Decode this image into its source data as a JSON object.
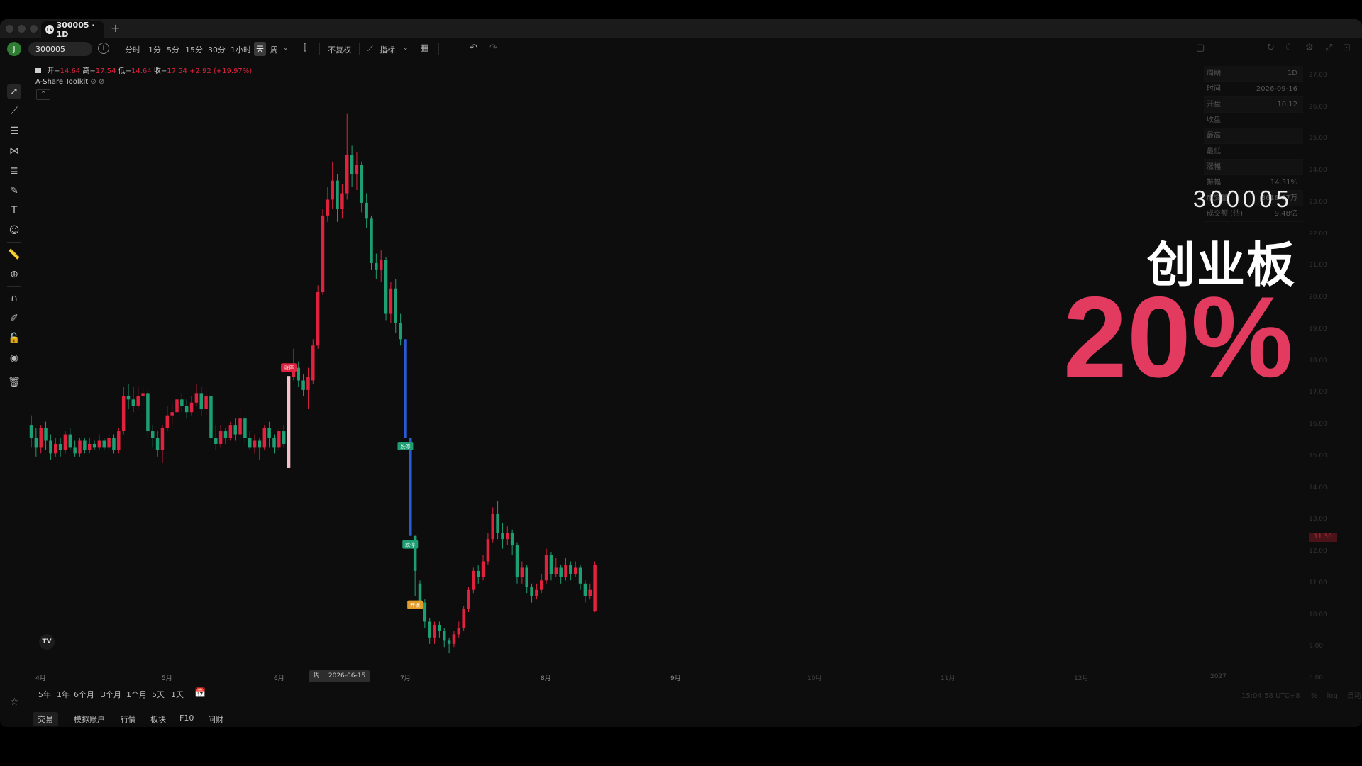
{
  "tab": {
    "title": "300005 · 1D",
    "logo": "TV",
    "new_tab": "+"
  },
  "toolbar": {
    "avatar": "J",
    "symbol": "300005",
    "add_symbol": "+",
    "intervals": [
      "分时",
      "1分",
      "5分",
      "15分",
      "30分",
      "1小时",
      "天",
      "周"
    ],
    "active_interval": "天",
    "adjust": "不复权",
    "indicators": "指标"
  },
  "legend": {
    "open_label": "开=",
    "open": "14.64",
    "high_label": "高=",
    "high": "17.54",
    "low_label": "低=",
    "low": "14.64",
    "close_label": "收=",
    "close": "17.54",
    "change": "+2.92 (+19.97%)"
  },
  "indicator": {
    "name": "A-Share Toolkit"
  },
  "info_panel": [
    {
      "label": "周期",
      "value": "1D"
    },
    {
      "label": "时间",
      "value": "2026-09-16"
    },
    {
      "label": "开盘",
      "value": "10.12"
    },
    {
      "label": "收盘",
      "value": ""
    },
    {
      "label": "最高",
      "value": ""
    },
    {
      "label": "最低",
      "value": ""
    },
    {
      "label": "涨幅",
      "value": ""
    },
    {
      "label": "振幅",
      "value": "14.31%"
    },
    {
      "label": "成交量",
      "value": "8618.87万"
    },
    {
      "label": "成交额 (估)",
      "value": "9.48亿"
    }
  ],
  "price_axis": [
    "27.00",
    "26.00",
    "25.00",
    "24.00",
    "23.00",
    "22.00",
    "21.00",
    "20.00",
    "19.00",
    "18.00",
    "17.00",
    "16.00",
    "15.00",
    "14.00",
    "13.00",
    "12.00",
    "11.00",
    "10.00",
    "9.00",
    "8.00"
  ],
  "price_tag": "11.30",
  "x_axis": [
    "4月",
    "5月",
    "6月",
    "7月",
    "8月",
    "9月",
    "10月",
    "11月",
    "12月",
    "2027"
  ],
  "x_hover": "周一 2026-06-15",
  "ranges": [
    "5年",
    "1年",
    "6个月",
    "3个月",
    "1个月",
    "5天",
    "1天"
  ],
  "timezone": "15:04:58 UTC+8",
  "axis_opts": [
    "%",
    "log",
    "自动"
  ],
  "bottom_tabs": [
    "交易",
    "模拟账户",
    "行情",
    "板块",
    "F10",
    "问财"
  ],
  "markers": {
    "limit_up": "涨停",
    "limit_down": "跌停",
    "open_board": "开板"
  },
  "overlay": {
    "code": "300005",
    "board": "创业板",
    "percent": "20%"
  },
  "colors": {
    "up": "#e0223f",
    "down": "#1e9e73",
    "limit_down_bar": "#2a5bd7",
    "limit_up_bar": "#f5c2cb",
    "overlay_pct": "#e33a60",
    "open_board": "#e39b2a"
  },
  "chart_data": {
    "type": "candlestick",
    "x_range": [
      "2026-04",
      "2027"
    ],
    "y_range": [
      8,
      27
    ],
    "candles": [
      {
        "o": 16.0,
        "c": 15.6,
        "h": 16.3,
        "l": 15.3
      },
      {
        "o": 15.6,
        "c": 15.3,
        "h": 15.9,
        "l": 15.0
      },
      {
        "o": 15.3,
        "c": 15.9,
        "h": 16.0,
        "l": 15.1
      },
      {
        "o": 15.9,
        "c": 15.5,
        "h": 16.1,
        "l": 15.2
      },
      {
        "o": 15.5,
        "c": 15.1,
        "h": 15.7,
        "l": 14.9
      },
      {
        "o": 15.1,
        "c": 15.4,
        "h": 15.6,
        "l": 15.0
      },
      {
        "o": 15.4,
        "c": 15.2,
        "h": 15.6,
        "l": 15.0
      },
      {
        "o": 15.2,
        "c": 15.7,
        "h": 15.8,
        "l": 15.1
      },
      {
        "o": 15.7,
        "c": 15.3,
        "h": 15.9,
        "l": 15.2
      },
      {
        "o": 15.3,
        "c": 15.1,
        "h": 15.5,
        "l": 15.0
      },
      {
        "o": 15.1,
        "c": 15.5,
        "h": 15.6,
        "l": 15.0
      },
      {
        "o": 15.5,
        "c": 15.2,
        "h": 15.6,
        "l": 15.1
      },
      {
        "o": 15.2,
        "c": 15.4,
        "h": 15.6,
        "l": 15.1
      },
      {
        "o": 15.4,
        "c": 15.3,
        "h": 15.5,
        "l": 15.2
      },
      {
        "o": 15.3,
        "c": 15.5,
        "h": 15.7,
        "l": 15.2
      },
      {
        "o": 15.5,
        "c": 15.3,
        "h": 15.6,
        "l": 15.2
      },
      {
        "o": 15.3,
        "c": 15.6,
        "h": 15.7,
        "l": 15.2
      },
      {
        "o": 15.6,
        "c": 15.2,
        "h": 15.7,
        "l": 15.1
      },
      {
        "o": 15.2,
        "c": 15.8,
        "h": 15.9,
        "l": 15.1
      },
      {
        "o": 15.8,
        "c": 16.9,
        "h": 17.2,
        "l": 15.7
      },
      {
        "o": 16.9,
        "c": 16.8,
        "h": 17.3,
        "l": 16.5
      },
      {
        "o": 16.8,
        "c": 16.6,
        "h": 17.2,
        "l": 16.4
      },
      {
        "o": 16.6,
        "c": 16.9,
        "h": 17.2,
        "l": 16.5
      },
      {
        "o": 16.9,
        "c": 17.0,
        "h": 17.2,
        "l": 16.6
      },
      {
        "o": 17.0,
        "c": 15.8,
        "h": 17.1,
        "l": 15.6
      },
      {
        "o": 15.8,
        "c": 15.6,
        "h": 16.0,
        "l": 15.3
      },
      {
        "o": 15.6,
        "c": 15.2,
        "h": 15.8,
        "l": 15.0
      },
      {
        "o": 15.2,
        "c": 15.9,
        "h": 16.0,
        "l": 14.8
      },
      {
        "o": 15.9,
        "c": 16.3,
        "h": 16.6,
        "l": 15.8
      },
      {
        "o": 16.3,
        "c": 16.4,
        "h": 16.7,
        "l": 16.0
      },
      {
        "o": 16.4,
        "c": 16.8,
        "h": 17.3,
        "l": 16.2
      },
      {
        "o": 16.8,
        "c": 16.6,
        "h": 17.0,
        "l": 16.4
      },
      {
        "o": 16.6,
        "c": 16.4,
        "h": 16.8,
        "l": 16.2
      },
      {
        "o": 16.4,
        "c": 16.7,
        "h": 16.9,
        "l": 16.3
      },
      {
        "o": 16.7,
        "c": 17.0,
        "h": 17.3,
        "l": 16.6
      },
      {
        "o": 17.0,
        "c": 16.5,
        "h": 17.2,
        "l": 16.3
      },
      {
        "o": 16.5,
        "c": 16.9,
        "h": 17.1,
        "l": 16.3
      },
      {
        "o": 16.9,
        "c": 15.6,
        "h": 17.0,
        "l": 15.4
      },
      {
        "o": 15.6,
        "c": 15.4,
        "h": 16.0,
        "l": 15.2
      },
      {
        "o": 15.4,
        "c": 15.8,
        "h": 16.0,
        "l": 15.3
      },
      {
        "o": 15.8,
        "c": 15.6,
        "h": 15.9,
        "l": 15.4
      },
      {
        "o": 15.6,
        "c": 16.0,
        "h": 16.1,
        "l": 15.5
      },
      {
        "o": 16.0,
        "c": 15.7,
        "h": 16.2,
        "l": 15.5
      },
      {
        "o": 15.7,
        "c": 16.2,
        "h": 16.6,
        "l": 15.6
      },
      {
        "o": 16.2,
        "c": 15.6,
        "h": 16.3,
        "l": 15.4
      },
      {
        "o": 15.6,
        "c": 15.3,
        "h": 15.8,
        "l": 15.2
      },
      {
        "o": 15.3,
        "c": 15.5,
        "h": 15.7,
        "l": 15.1
      },
      {
        "o": 15.5,
        "c": 15.3,
        "h": 15.6,
        "l": 14.9
      },
      {
        "o": 15.3,
        "c": 15.9,
        "h": 16.0,
        "l": 15.2
      },
      {
        "o": 15.9,
        "c": 15.6,
        "h": 16.1,
        "l": 15.3
      },
      {
        "o": 15.6,
        "c": 15.3,
        "h": 15.7,
        "l": 15.1
      },
      {
        "o": 15.3,
        "c": 15.8,
        "h": 15.9,
        "l": 15.2
      },
      {
        "o": 15.8,
        "c": 15.4,
        "h": 16.0,
        "l": 15.3
      },
      {
        "o": 14.64,
        "c": 17.54,
        "h": 17.54,
        "l": 14.64,
        "limit": "up"
      },
      {
        "o": 17.5,
        "c": 17.8,
        "h": 18.4,
        "l": 17.4
      },
      {
        "o": 17.8,
        "c": 17.4,
        "h": 18.0,
        "l": 17.2
      },
      {
        "o": 17.4,
        "c": 17.1,
        "h": 17.6,
        "l": 16.9
      },
      {
        "o": 17.1,
        "c": 17.5,
        "h": 17.8,
        "l": 16.5
      },
      {
        "o": 17.4,
        "c": 18.5,
        "h": 18.7,
        "l": 17.3
      },
      {
        "o": 18.5,
        "c": 20.2,
        "h": 20.4,
        "l": 18.4
      },
      {
        "o": 20.2,
        "c": 22.6,
        "h": 22.8,
        "l": 20.1
      },
      {
        "o": 22.6,
        "c": 23.1,
        "h": 23.5,
        "l": 22.4
      },
      {
        "o": 23.1,
        "c": 23.7,
        "h": 24.3,
        "l": 22.8
      },
      {
        "o": 23.7,
        "c": 22.8,
        "h": 23.9,
        "l": 22.4
      },
      {
        "o": 22.8,
        "c": 23.3,
        "h": 23.6,
        "l": 22.5
      },
      {
        "o": 23.3,
        "c": 24.5,
        "h": 25.8,
        "l": 23.1
      },
      {
        "o": 24.5,
        "c": 23.9,
        "h": 24.8,
        "l": 23.5
      },
      {
        "o": 23.9,
        "c": 24.2,
        "h": 24.6,
        "l": 23.4
      },
      {
        "o": 24.2,
        "c": 23.0,
        "h": 24.3,
        "l": 22.7
      },
      {
        "o": 23.0,
        "c": 22.5,
        "h": 23.3,
        "l": 22.2
      },
      {
        "o": 22.5,
        "c": 21.1,
        "h": 22.6,
        "l": 20.9
      },
      {
        "o": 21.1,
        "c": 20.9,
        "h": 21.4,
        "l": 20.6
      },
      {
        "o": 20.9,
        "c": 21.2,
        "h": 21.5,
        "l": 20.5
      },
      {
        "o": 21.2,
        "c": 19.5,
        "h": 21.3,
        "l": 19.3
      },
      {
        "o": 19.5,
        "c": 20.3,
        "h": 20.5,
        "l": 19.2
      },
      {
        "o": 20.3,
        "c": 19.2,
        "h": 20.6,
        "l": 18.9
      },
      {
        "o": 19.2,
        "c": 18.7,
        "h": 19.5,
        "l": 18.5
      },
      {
        "o": 18.7,
        "c": 15.6,
        "h": 18.7,
        "l": 15.6,
        "limit": "down"
      },
      {
        "o": 15.6,
        "c": 12.5,
        "h": 15.6,
        "l": 12.5,
        "limit": "down"
      },
      {
        "o": 12.5,
        "c": 11.4,
        "h": 12.5,
        "l": 10.6
      },
      {
        "o": 11.0,
        "c": 10.4,
        "h": 11.1,
        "l": 10.2
      },
      {
        "o": 10.4,
        "c": 9.8,
        "h": 10.5,
        "l": 9.6
      },
      {
        "o": 9.8,
        "c": 9.3,
        "h": 9.9,
        "l": 9.1
      },
      {
        "o": 9.3,
        "c": 9.7,
        "h": 9.8,
        "l": 9.1
      },
      {
        "o": 9.7,
        "c": 9.5,
        "h": 9.8,
        "l": 9.3
      },
      {
        "o": 9.5,
        "c": 9.2,
        "h": 9.6,
        "l": 9.0
      },
      {
        "o": 9.2,
        "c": 9.1,
        "h": 9.3,
        "l": 8.8
      },
      {
        "o": 9.1,
        "c": 9.4,
        "h": 9.5,
        "l": 9.0
      },
      {
        "o": 9.4,
        "c": 9.6,
        "h": 9.8,
        "l": 9.3
      },
      {
        "o": 9.6,
        "c": 10.2,
        "h": 10.3,
        "l": 9.5
      },
      {
        "o": 10.2,
        "c": 10.8,
        "h": 10.9,
        "l": 10.1
      },
      {
        "o": 10.8,
        "c": 11.4,
        "h": 11.5,
        "l": 10.7
      },
      {
        "o": 11.4,
        "c": 11.2,
        "h": 11.6,
        "l": 11.0
      },
      {
        "o": 11.2,
        "c": 11.7,
        "h": 11.9,
        "l": 11.1
      },
      {
        "o": 11.7,
        "c": 12.4,
        "h": 12.6,
        "l": 11.6
      },
      {
        "o": 12.4,
        "c": 13.2,
        "h": 13.4,
        "l": 12.3
      },
      {
        "o": 13.2,
        "c": 12.6,
        "h": 13.6,
        "l": 12.4
      },
      {
        "o": 12.6,
        "c": 12.4,
        "h": 12.9,
        "l": 12.1
      },
      {
        "o": 12.4,
        "c": 12.6,
        "h": 12.8,
        "l": 12.2
      },
      {
        "o": 12.6,
        "c": 12.2,
        "h": 12.7,
        "l": 11.9
      },
      {
        "o": 12.2,
        "c": 11.2,
        "h": 12.3,
        "l": 11.0
      },
      {
        "o": 11.2,
        "c": 11.5,
        "h": 11.7,
        "l": 11.0
      },
      {
        "o": 11.5,
        "c": 10.9,
        "h": 11.6,
        "l": 10.7
      },
      {
        "o": 10.9,
        "c": 10.6,
        "h": 11.0,
        "l": 10.4
      },
      {
        "o": 10.6,
        "c": 10.8,
        "h": 11.0,
        "l": 10.5
      },
      {
        "o": 10.8,
        "c": 11.1,
        "h": 11.3,
        "l": 10.7
      },
      {
        "o": 11.1,
        "c": 11.9,
        "h": 12.1,
        "l": 11.0
      },
      {
        "o": 11.9,
        "c": 11.3,
        "h": 12.0,
        "l": 11.1
      },
      {
        "o": 11.3,
        "c": 11.5,
        "h": 11.8,
        "l": 11.2
      },
      {
        "o": 11.5,
        "c": 11.2,
        "h": 11.6,
        "l": 11.0
      },
      {
        "o": 11.2,
        "c": 11.6,
        "h": 11.8,
        "l": 11.1
      },
      {
        "o": 11.6,
        "c": 11.3,
        "h": 11.7,
        "l": 11.1
      },
      {
        "o": 11.3,
        "c": 11.5,
        "h": 11.7,
        "l": 11.2
      },
      {
        "o": 11.5,
        "c": 11.0,
        "h": 11.6,
        "l": 10.8
      },
      {
        "o": 11.0,
        "c": 10.6,
        "h": 11.1,
        "l": 10.4
      },
      {
        "o": 10.6,
        "c": 10.8,
        "h": 11.0,
        "l": 10.5
      },
      {
        "o": 10.12,
        "c": 11.6,
        "h": 11.7,
        "l": 10.1
      }
    ]
  }
}
